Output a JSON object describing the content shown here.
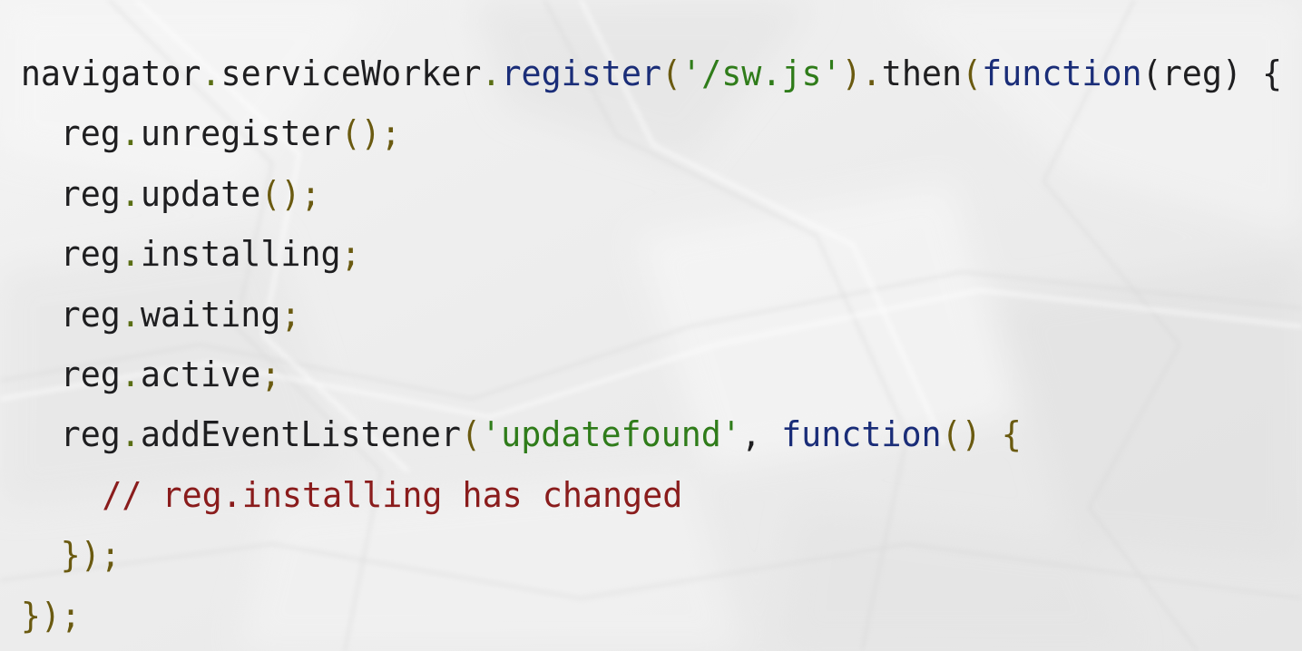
{
  "colors": {
    "identifier": "#1e1e20",
    "property": "#5a6e14",
    "method": "#1a2d78",
    "string": "#2f7c1a",
    "punct": "#6a5a10",
    "comment": "#8a1c1c",
    "keyword": "#1a2d78"
  },
  "code_lines": [
    {
      "indent": 0,
      "tokens": [
        {
          "t": "navigator",
          "k": "identifier"
        },
        {
          "t": ".",
          "k": "property"
        },
        {
          "t": "serviceWorker",
          "k": "identifier"
        },
        {
          "t": ".",
          "k": "property"
        },
        {
          "t": "register",
          "k": "method"
        },
        {
          "t": "(",
          "k": "punct"
        },
        {
          "t": "'/sw.js'",
          "k": "string"
        },
        {
          "t": ").",
          "k": "punct"
        },
        {
          "t": "then",
          "k": "identifier"
        },
        {
          "t": "(",
          "k": "punct"
        },
        {
          "t": "function",
          "k": "keyword"
        },
        {
          "t": "(reg) {",
          "k": "identifier"
        }
      ]
    },
    {
      "indent": 1,
      "tokens": [
        {
          "t": "reg",
          "k": "identifier"
        },
        {
          "t": ".",
          "k": "property"
        },
        {
          "t": "unregister",
          "k": "identifier"
        },
        {
          "t": "();",
          "k": "punct"
        }
      ]
    },
    {
      "indent": 1,
      "tokens": [
        {
          "t": "reg",
          "k": "identifier"
        },
        {
          "t": ".",
          "k": "property"
        },
        {
          "t": "update",
          "k": "identifier"
        },
        {
          "t": "();",
          "k": "punct"
        }
      ]
    },
    {
      "indent": 1,
      "tokens": [
        {
          "t": "reg",
          "k": "identifier"
        },
        {
          "t": ".",
          "k": "property"
        },
        {
          "t": "installing",
          "k": "identifier"
        },
        {
          "t": ";",
          "k": "punct"
        }
      ]
    },
    {
      "indent": 1,
      "tokens": [
        {
          "t": "reg",
          "k": "identifier"
        },
        {
          "t": ".",
          "k": "property"
        },
        {
          "t": "waiting",
          "k": "identifier"
        },
        {
          "t": ";",
          "k": "punct"
        }
      ]
    },
    {
      "indent": 1,
      "tokens": [
        {
          "t": "reg",
          "k": "identifier"
        },
        {
          "t": ".",
          "k": "property"
        },
        {
          "t": "active",
          "k": "identifier"
        },
        {
          "t": ";",
          "k": "punct"
        }
      ]
    },
    {
      "indent": 1,
      "tokens": [
        {
          "t": "reg",
          "k": "identifier"
        },
        {
          "t": ".",
          "k": "property"
        },
        {
          "t": "addEventListener",
          "k": "identifier"
        },
        {
          "t": "(",
          "k": "punct"
        },
        {
          "t": "'updatefound'",
          "k": "string"
        },
        {
          "t": ", ",
          "k": "identifier"
        },
        {
          "t": "function",
          "k": "keyword"
        },
        {
          "t": "() {",
          "k": "punct"
        }
      ]
    },
    {
      "indent": 2,
      "tokens": [
        {
          "t": "// reg.installing has changed",
          "k": "comment"
        }
      ]
    },
    {
      "indent": 1,
      "tokens": [
        {
          "t": "});",
          "k": "punct"
        }
      ]
    },
    {
      "indent": 0,
      "tokens": [
        {
          "t": "});",
          "k": "punct"
        }
      ]
    }
  ]
}
